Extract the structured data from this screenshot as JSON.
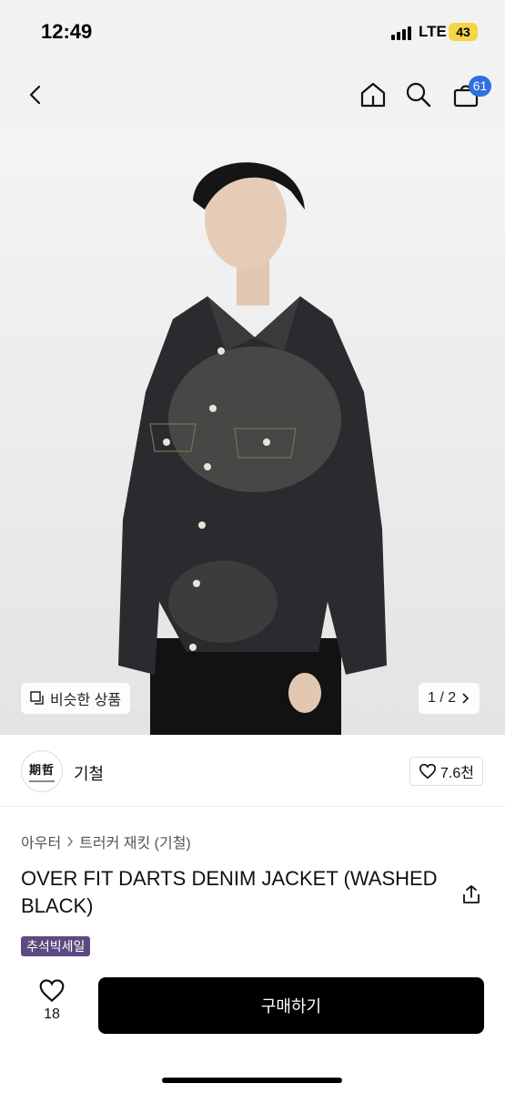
{
  "status_bar": {
    "time": "12:49",
    "network": "LTE",
    "battery": "43"
  },
  "nav": {
    "cart_count": "61",
    "icons": [
      "back-icon",
      "home-icon",
      "search-icon",
      "cart-icon"
    ]
  },
  "image": {
    "similar_label": "비슷한 상품",
    "page_indicator": "1 / 2"
  },
  "brand": {
    "name": "기철",
    "logo_text": "期哲",
    "likes": "7.6천"
  },
  "breadcrumb": {
    "category": "아우터",
    "subcategory": "트러커 재킷 (기철)"
  },
  "product": {
    "title": "OVER FIT DARTS DENIM JACKET (WASHED BLACK)",
    "badge": "추석빅세일"
  },
  "bottom_bar": {
    "like_count": "18",
    "buy_label": "구매하기"
  },
  "colors": {
    "accent": "#2f6fe0",
    "badge": "#5c4a80",
    "button": "#000000"
  }
}
